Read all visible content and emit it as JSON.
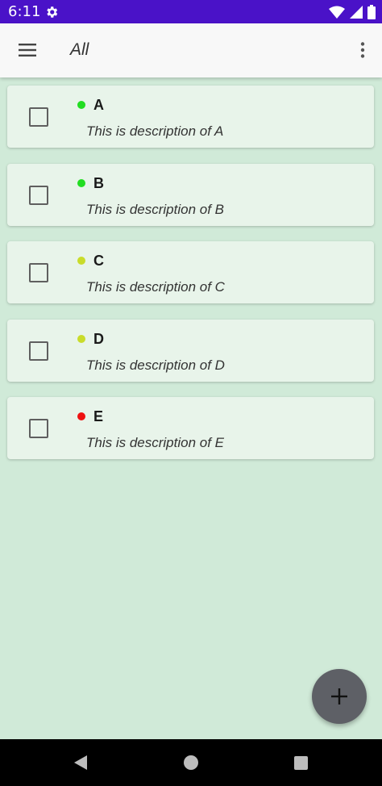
{
  "status_bar": {
    "time": "6:11",
    "icons": [
      "gear-icon",
      "wifi-icon",
      "cellular-icon",
      "battery-icon"
    ]
  },
  "app_bar": {
    "title": "All",
    "menu_icon": "hamburger-menu-icon",
    "overflow_icon": "more-vert-icon"
  },
  "tasks": [
    {
      "title": "A",
      "description": "This is description of A",
      "priority_color": "#22dd22",
      "checked": false
    },
    {
      "title": "B",
      "description": "This is description of B",
      "priority_color": "#22dd22",
      "checked": false
    },
    {
      "title": "C",
      "description": "This is description of C",
      "priority_color": "#c9dc2a",
      "checked": false
    },
    {
      "title": "D",
      "description": "This is description of D",
      "priority_color": "#c9dc2a",
      "checked": false
    },
    {
      "title": "E",
      "description": "This is description of E",
      "priority_color": "#ee1111",
      "checked": false
    }
  ],
  "fab": {
    "icon": "plus-icon"
  },
  "nav_bar": {
    "icons": [
      "back-icon",
      "home-icon",
      "recents-icon"
    ]
  },
  "colors": {
    "status_bar": "#4a12c8",
    "app_bar": "#f8f8f8",
    "background": "#d0ead8",
    "card": "#e8f4ea",
    "fab": "#5e6066"
  }
}
